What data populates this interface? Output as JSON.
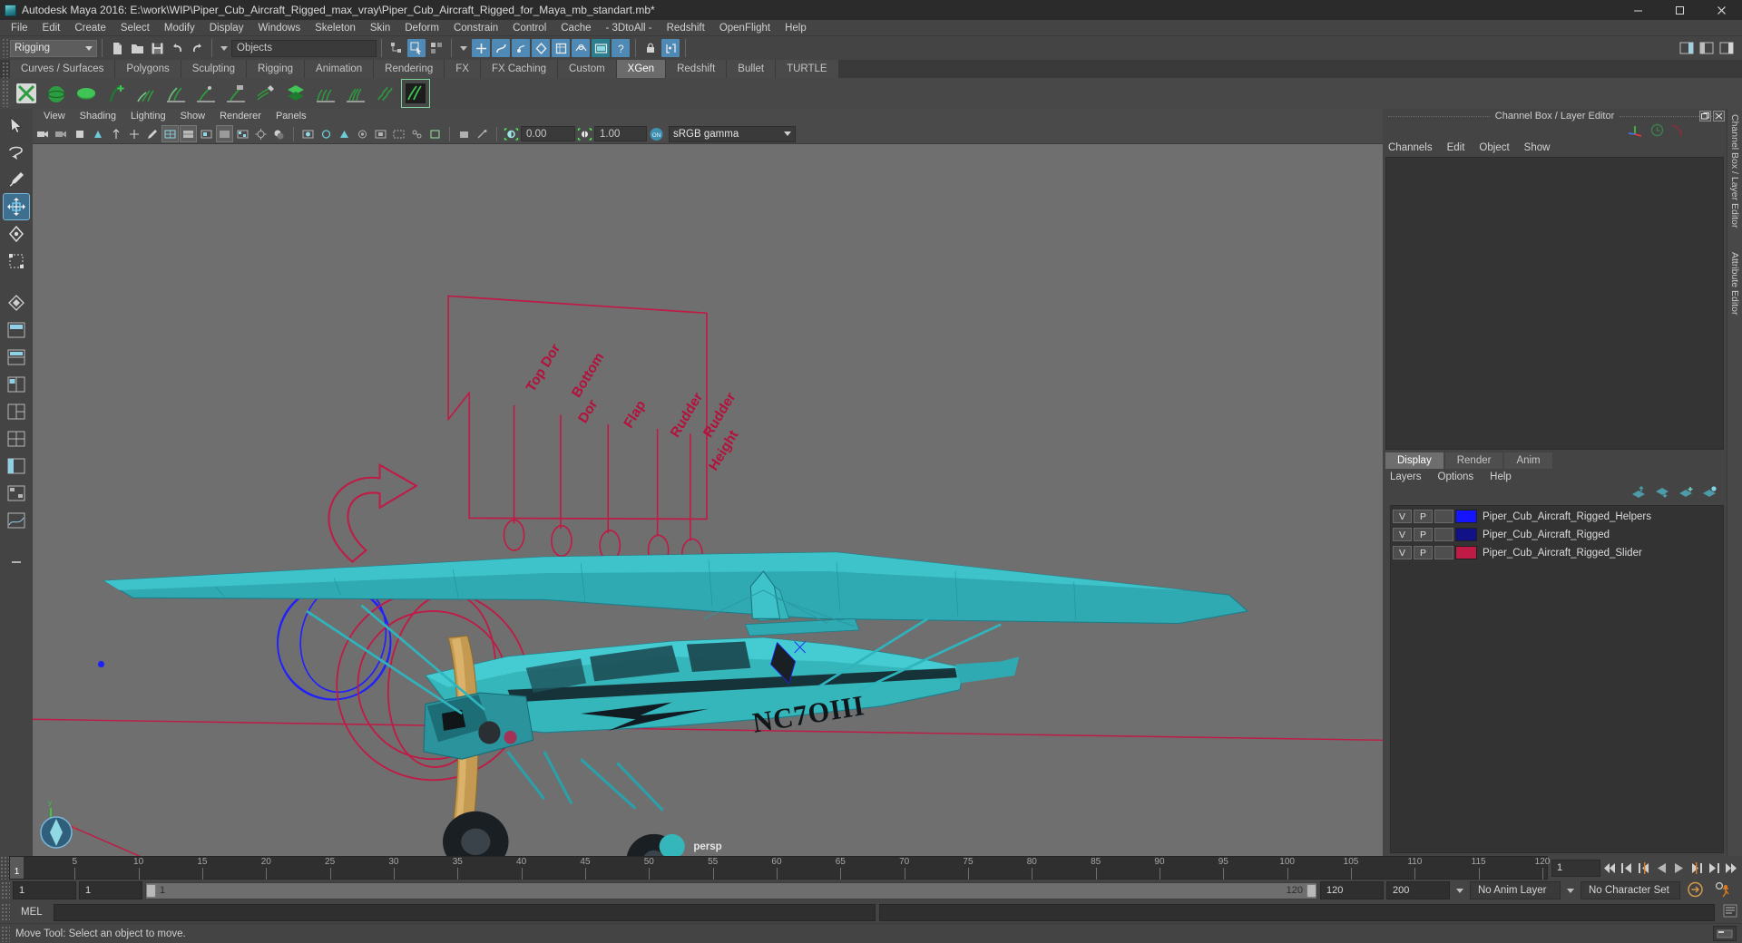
{
  "window": {
    "title": "Autodesk Maya 2016: E:\\work\\WIP\\Piper_Cub_Aircraft_Rigged_max_vray\\Piper_Cub_Aircraft_Rigged_for_Maya_mb_standart.mb*",
    "minimize": "–",
    "maximize": "□",
    "close": "✕"
  },
  "menubar": {
    "items": [
      "File",
      "Edit",
      "Create",
      "Select",
      "Modify",
      "Display",
      "Windows",
      "Skeleton",
      "Skin",
      "Deform",
      "Constrain",
      "Control",
      "Cache",
      "- 3DtoAll -",
      "Redshift",
      "OpenFlight",
      "Help"
    ]
  },
  "statusline": {
    "menuset": "Rigging",
    "selection_mask": "Objects"
  },
  "shelf": {
    "tabs": [
      "Curves / Surfaces",
      "Polygons",
      "Sculpting",
      "Rigging",
      "Animation",
      "Rendering",
      "FX",
      "FX Caching",
      "Custom",
      "XGen",
      "Redshift",
      "Bullet",
      "TURTLE"
    ],
    "active_tab": "XGen"
  },
  "viewport": {
    "menus": [
      "View",
      "Shading",
      "Lighting",
      "Show",
      "Renderer",
      "Panels"
    ],
    "exposure": "0.00",
    "gamma": "1.00",
    "color_profile": "sRGB gamma",
    "camera_label": "persp",
    "axis_x": "x",
    "axis_y": "y",
    "axis_z": "z",
    "scene": {
      "aircraft_registration": "NC7OIII",
      "control_panel_labels": [
        "Top Dor",
        "Bottom Dor",
        "Flap",
        "Rudder",
        "Rudder Height"
      ],
      "body_color": "#35b6bb",
      "rig_color": "#c01b46",
      "helper_color": "#2020ff",
      "background_color": "#6f6f6f"
    }
  },
  "channelbox": {
    "panel_title": "Channel Box / Layer Editor",
    "vertical_tab_1": "Channel Box / Layer Editor",
    "vertical_tab_2": "Attribute Editor",
    "menus": [
      "Channels",
      "Edit",
      "Object",
      "Show"
    ]
  },
  "layer_editor": {
    "tabs": [
      "Display",
      "Render",
      "Anim"
    ],
    "active_tab": "Display",
    "menus": [
      "Layers",
      "Options",
      "Help"
    ],
    "column_v": "V",
    "column_p": "P",
    "layers": [
      {
        "v": "V",
        "p": "P",
        "t": "",
        "color": "#1414ff",
        "name": "Piper_Cub_Aircraft_Rigged_Helpers"
      },
      {
        "v": "V",
        "p": "P",
        "t": "",
        "color": "#111188",
        "name": "Piper_Cub_Aircraft_Rigged"
      },
      {
        "v": "V",
        "p": "P",
        "t": "",
        "color": "#c01b46",
        "name": "Piper_Cub_Aircraft_Rigged_Slider"
      }
    ]
  },
  "timeline": {
    "ticks": [
      5,
      10,
      15,
      20,
      25,
      30,
      35,
      40,
      45,
      50,
      55,
      60,
      65,
      70,
      75,
      80,
      85,
      90,
      95,
      100,
      105,
      110,
      115,
      120
    ],
    "start": 1,
    "end": 120,
    "current_frame": "1",
    "current_frame_field": "1"
  },
  "range": {
    "anim_start": "1",
    "range_start": "1",
    "bar_start_label": "1",
    "bar_end_label": "120",
    "range_end": "120",
    "anim_end": "200",
    "anim_layer": "No Anim Layer",
    "character_set": "No Character Set"
  },
  "command_line": {
    "language": "MEL",
    "value": ""
  },
  "statusbar": {
    "message": "Move Tool: Select an object to move."
  }
}
